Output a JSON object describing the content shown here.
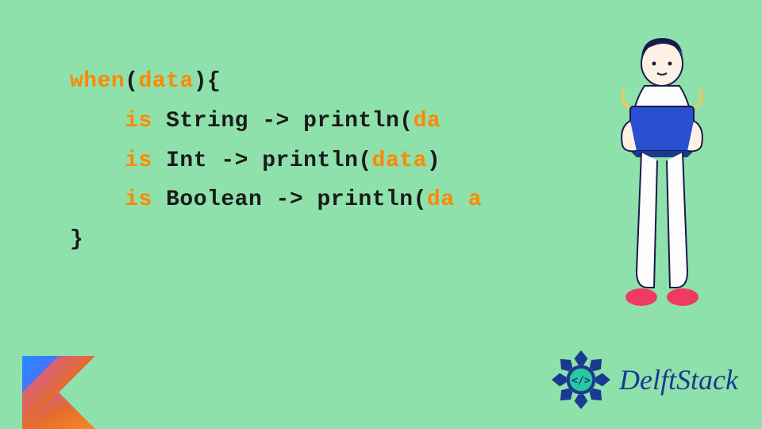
{
  "code": {
    "lines": [
      [
        {
          "cls": "kw",
          "text": "when"
        },
        {
          "cls": "txt",
          "text": "("
        },
        {
          "cls": "kw",
          "text": "data"
        },
        {
          "cls": "txt",
          "text": "){"
        }
      ],
      [
        {
          "cls": "txt",
          "text": "    "
        },
        {
          "cls": "kw",
          "text": "is"
        },
        {
          "cls": "txt",
          "text": " String -> println("
        },
        {
          "cls": "kw",
          "text": "da"
        }
      ],
      [
        {
          "cls": "txt",
          "text": "    "
        },
        {
          "cls": "kw",
          "text": "is"
        },
        {
          "cls": "txt",
          "text": " Int -> println("
        },
        {
          "cls": "kw",
          "text": "data"
        },
        {
          "cls": "txt",
          "text": ")"
        }
      ],
      [
        {
          "cls": "txt",
          "text": "    "
        },
        {
          "cls": "kw",
          "text": "is"
        },
        {
          "cls": "txt",
          "text": " Boolean -> println("
        },
        {
          "cls": "kw",
          "text": "da a"
        }
      ],
      [
        {
          "cls": "txt",
          "text": "}"
        }
      ]
    ]
  },
  "brand": {
    "name": "DelftStack"
  },
  "icons": {
    "kotlin": "kotlin-logo",
    "delft_badge": "delft-badge-icon",
    "person": "person-with-laptop-illustration"
  },
  "colors": {
    "bg": "#8ee1ab",
    "keyword": "#ff8800",
    "text": "#1a1a1a",
    "brand": "#1a3a8f",
    "kotlin_orange": "#f68b1f",
    "kotlin_purple": "#6b57ff",
    "laptop": "#2850d0",
    "shoes": "#ef3a62"
  }
}
